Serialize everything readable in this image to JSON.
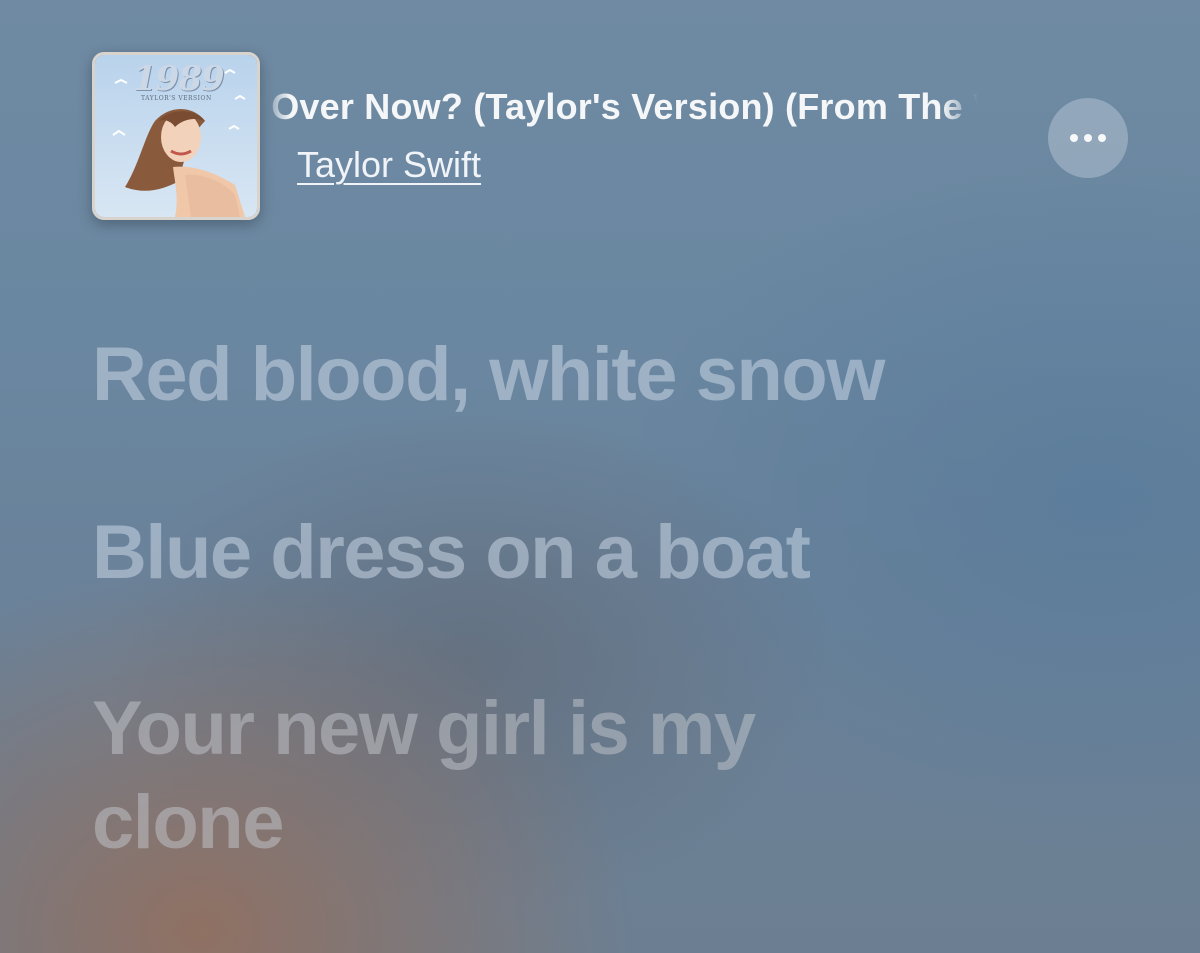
{
  "now_playing": {
    "song_title": "Is It Over Now? (Taylor's Version) (From The Vault)",
    "artist": "Taylor Swift",
    "artwork": {
      "title": "1989",
      "subtitle": "TAYLOR'S VERSION"
    },
    "more_icon": "ellipsis-icon"
  },
  "lyrics": {
    "lines": [
      "Red blood, white snow",
      "Blue dress on a boat",
      "Your new girl is my clone"
    ]
  },
  "colors": {
    "title_text": "#f4f6f8",
    "lyric_inactive": "rgba(200,214,228,0.55)",
    "more_button_bg": "rgba(190,205,218,0.45)"
  }
}
